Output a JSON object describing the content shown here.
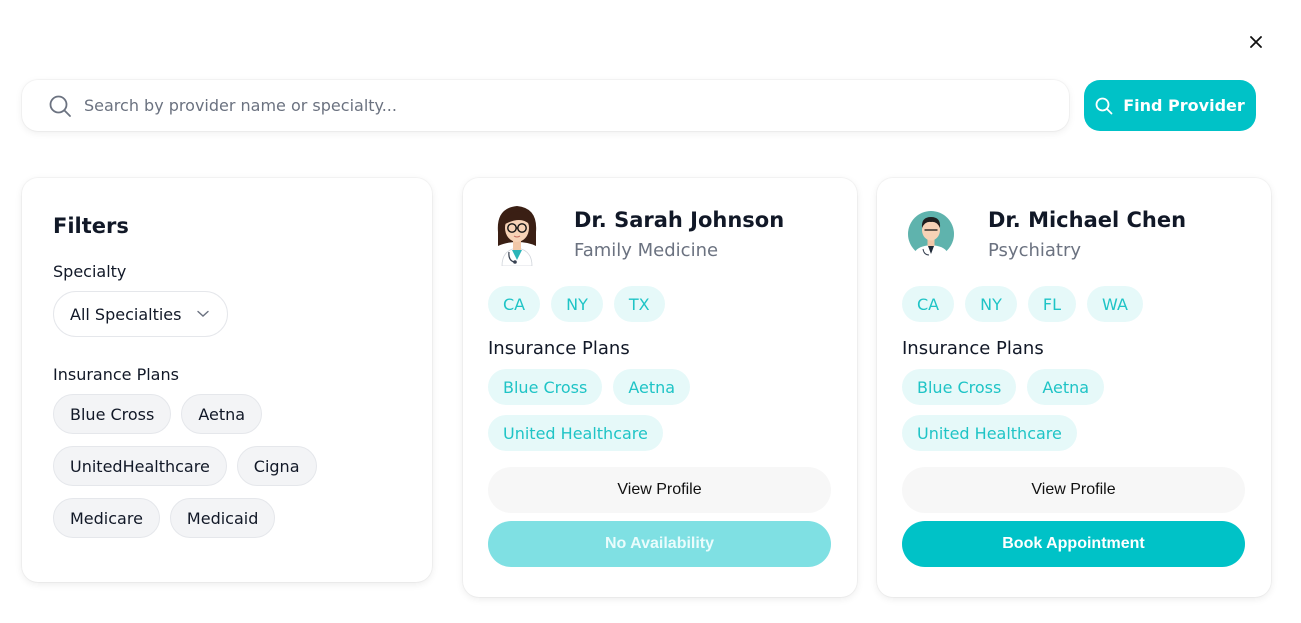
{
  "search": {
    "placeholder": "Search by provider name or specialty...",
    "button_label": "Find Provider"
  },
  "filters": {
    "title": "Filters",
    "specialty_label": "Specialty",
    "specialty_value": "All Specialties",
    "insurance_label": "Insurance Plans",
    "insurance_options": [
      "Blue Cross",
      "Aetna",
      "UnitedHealthcare",
      "Cigna",
      "Medicare",
      "Medicaid"
    ]
  },
  "providers": [
    {
      "name": "Dr. Sarah Johnson",
      "specialty": "Family Medicine",
      "states": [
        "CA",
        "NY",
        "TX"
      ],
      "insurance_title": "Insurance Plans",
      "insurance": [
        "Blue Cross",
        "Aetna",
        "United Healthcare"
      ],
      "profile_label": "View Profile",
      "action_label": "No Availability",
      "available": false
    },
    {
      "name": "Dr. Michael Chen",
      "specialty": "Psychiatry",
      "states": [
        "CA",
        "NY",
        "FL",
        "WA"
      ],
      "insurance_title": "Insurance Plans",
      "insurance": [
        "Blue Cross",
        "Aetna",
        "United Healthcare"
      ],
      "profile_label": "View Profile",
      "action_label": "Book Appointment",
      "available": true
    }
  ],
  "colors": {
    "accent": "#00c2c7",
    "accent_disabled": "#7fe0e3",
    "tag_bg": "#e6f9f9",
    "tag_text": "#1fc4c6"
  },
  "icons": {
    "close": "close-icon",
    "search": "search-icon",
    "chevron": "chevron-down-icon"
  }
}
